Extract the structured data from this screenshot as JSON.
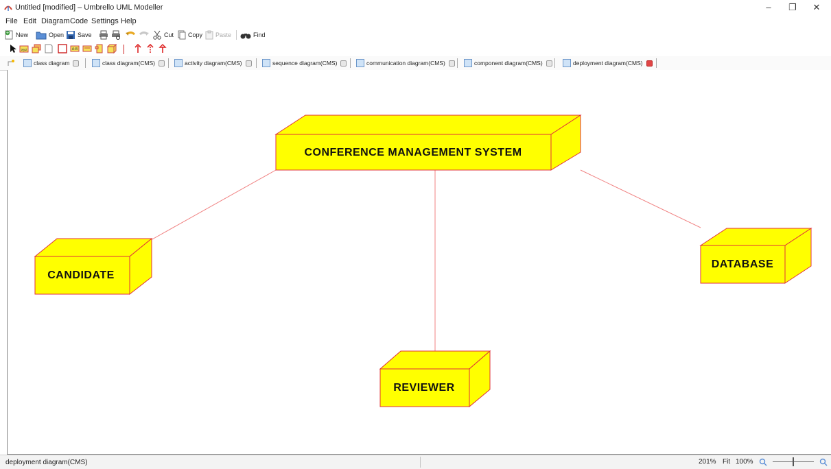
{
  "window": {
    "title": "Untitled [modified] – Umbrello UML Modeller",
    "controls": {
      "minimize": "–",
      "restore": "❐",
      "close": "✕"
    }
  },
  "menu": [
    "File",
    "Edit",
    "Diagram",
    "Code",
    "Settings",
    "Help"
  ],
  "toolbar": {
    "new": "New",
    "open": "Open",
    "save": "Save",
    "cut": "Cut",
    "copy": "Copy",
    "paste": "Paste",
    "find": "Find"
  },
  "tabs": [
    {
      "label": "class diagram",
      "active": false
    },
    {
      "label": "class diagram(CMS)",
      "active": false
    },
    {
      "label": "activity diagram(CMS)",
      "active": false
    },
    {
      "label": "sequence diagram(CMS)",
      "active": false
    },
    {
      "label": "communication diagram(CMS)",
      "active": false
    },
    {
      "label": "component diagram(CMS)",
      "active": false
    },
    {
      "label": "deployment diagram(CMS)",
      "active": true
    }
  ],
  "diagram": {
    "nodes": {
      "cms": "CONFERENCE MANAGEMENT SYSTEM",
      "candidate": "CANDIDATE",
      "database": "DATABASE",
      "reviewer": "REVIEWER"
    },
    "node_fill": "#ffff00",
    "node_stroke": "#e0303a",
    "connector_color": "#f08080"
  },
  "status": {
    "left": "deployment diagram(CMS)",
    "zoom": "201%",
    "fit": "Fit",
    "hundred": "100%"
  }
}
